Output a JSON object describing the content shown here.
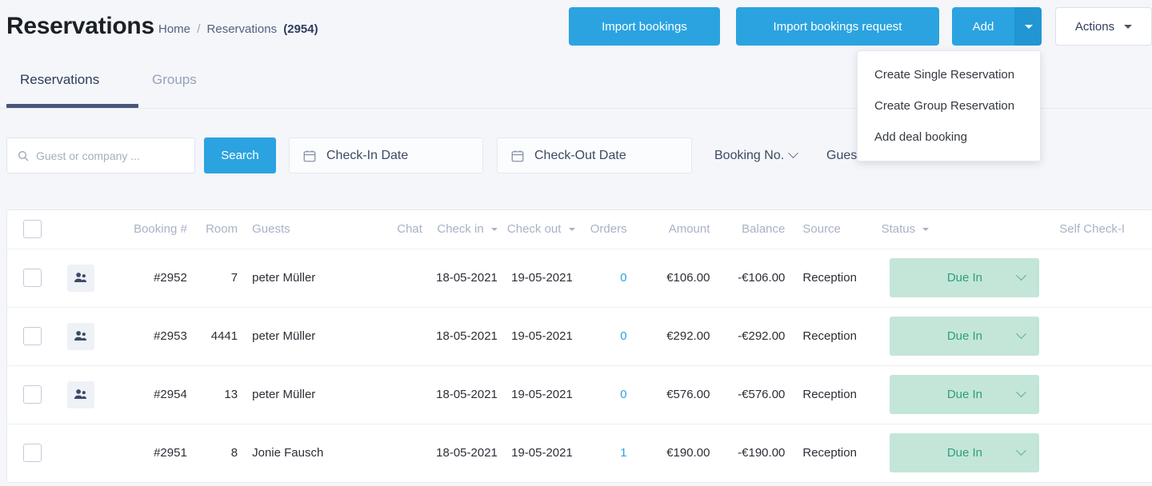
{
  "header": {
    "title": "Reservations",
    "breadcrumb": {
      "home": "Home",
      "separator": "/",
      "current": "Reservations",
      "count": "(2954)"
    },
    "buttons": {
      "import_bookings": "Import bookings",
      "import_bookings_request": "Import bookings request",
      "add": "Add",
      "actions": "Actions"
    }
  },
  "dropdown": {
    "open": true,
    "items": [
      {
        "label": "Create Single Reservation"
      },
      {
        "label": "Create Group Reservation"
      },
      {
        "label": "Add deal booking"
      }
    ]
  },
  "tabs": [
    {
      "label": "Reservations",
      "active": true
    },
    {
      "label": "Groups",
      "active": false
    }
  ],
  "filters": {
    "search_placeholder": "Guest or company ...",
    "search_value": "",
    "search_button": "Search",
    "check_in_date": "Check-In Date",
    "check_out_date": "Check-Out Date",
    "booking_no": "Booking No.",
    "guests": "Gues"
  },
  "table": {
    "columns": [
      {
        "key": "select",
        "label": ""
      },
      {
        "key": "icon",
        "label": ""
      },
      {
        "key": "booking",
        "label": "Booking #"
      },
      {
        "key": "room",
        "label": "Room"
      },
      {
        "key": "guests",
        "label": "Guests"
      },
      {
        "key": "chat",
        "label": "Chat"
      },
      {
        "key": "checkin",
        "label": "Check in",
        "sortable": true
      },
      {
        "key": "checkout",
        "label": "Check out",
        "sortable": true
      },
      {
        "key": "orders",
        "label": "Orders"
      },
      {
        "key": "amount",
        "label": "Amount"
      },
      {
        "key": "balance",
        "label": "Balance"
      },
      {
        "key": "source",
        "label": "Source"
      },
      {
        "key": "status",
        "label": "Status",
        "sortable": true
      },
      {
        "key": "selfcheckin",
        "label": "Self Check-I"
      }
    ],
    "rows": [
      {
        "booking": "#2952",
        "room": "7",
        "guests": "peter Müller",
        "chat": "",
        "checkin": "18-05-2021",
        "checkout": "19-05-2021",
        "orders": "0",
        "amount": "€106.00",
        "balance": "-€106.00",
        "source": "Reception",
        "status": "Due In",
        "has_guest_icon": true
      },
      {
        "booking": "#2953",
        "room": "4441",
        "guests": "peter Müller",
        "chat": "",
        "checkin": "18-05-2021",
        "checkout": "19-05-2021",
        "orders": "0",
        "amount": "€292.00",
        "balance": "-€292.00",
        "source": "Reception",
        "status": "Due In",
        "has_guest_icon": true
      },
      {
        "booking": "#2954",
        "room": "13",
        "guests": "peter Müller",
        "chat": "",
        "checkin": "18-05-2021",
        "checkout": "19-05-2021",
        "orders": "0",
        "amount": "€576.00",
        "balance": "-€576.00",
        "source": "Reception",
        "status": "Due In",
        "has_guest_icon": true
      },
      {
        "booking": "#2951",
        "room": "8",
        "guests": "Jonie Fausch",
        "chat": "",
        "checkin": "18-05-2021",
        "checkout": "19-05-2021",
        "orders": "1",
        "amount": "€190.00",
        "balance": "-€190.00",
        "source": "Reception",
        "status": "Due In",
        "has_guest_icon": false
      }
    ]
  },
  "colors": {
    "accent_blue": "#2ba3e0",
    "page_background": "#f4f6fa",
    "status_badge_bg": "#c3e6d8",
    "status_badge_text": "#2f9e7d",
    "tab_underline": "#4a5578",
    "header_text_muted": "#a8b2c6"
  },
  "icons": {
    "search": "search-icon",
    "calendar": "calendar-icon",
    "chevron_down": "chevron-down-icon",
    "guests": "guests-icon"
  }
}
